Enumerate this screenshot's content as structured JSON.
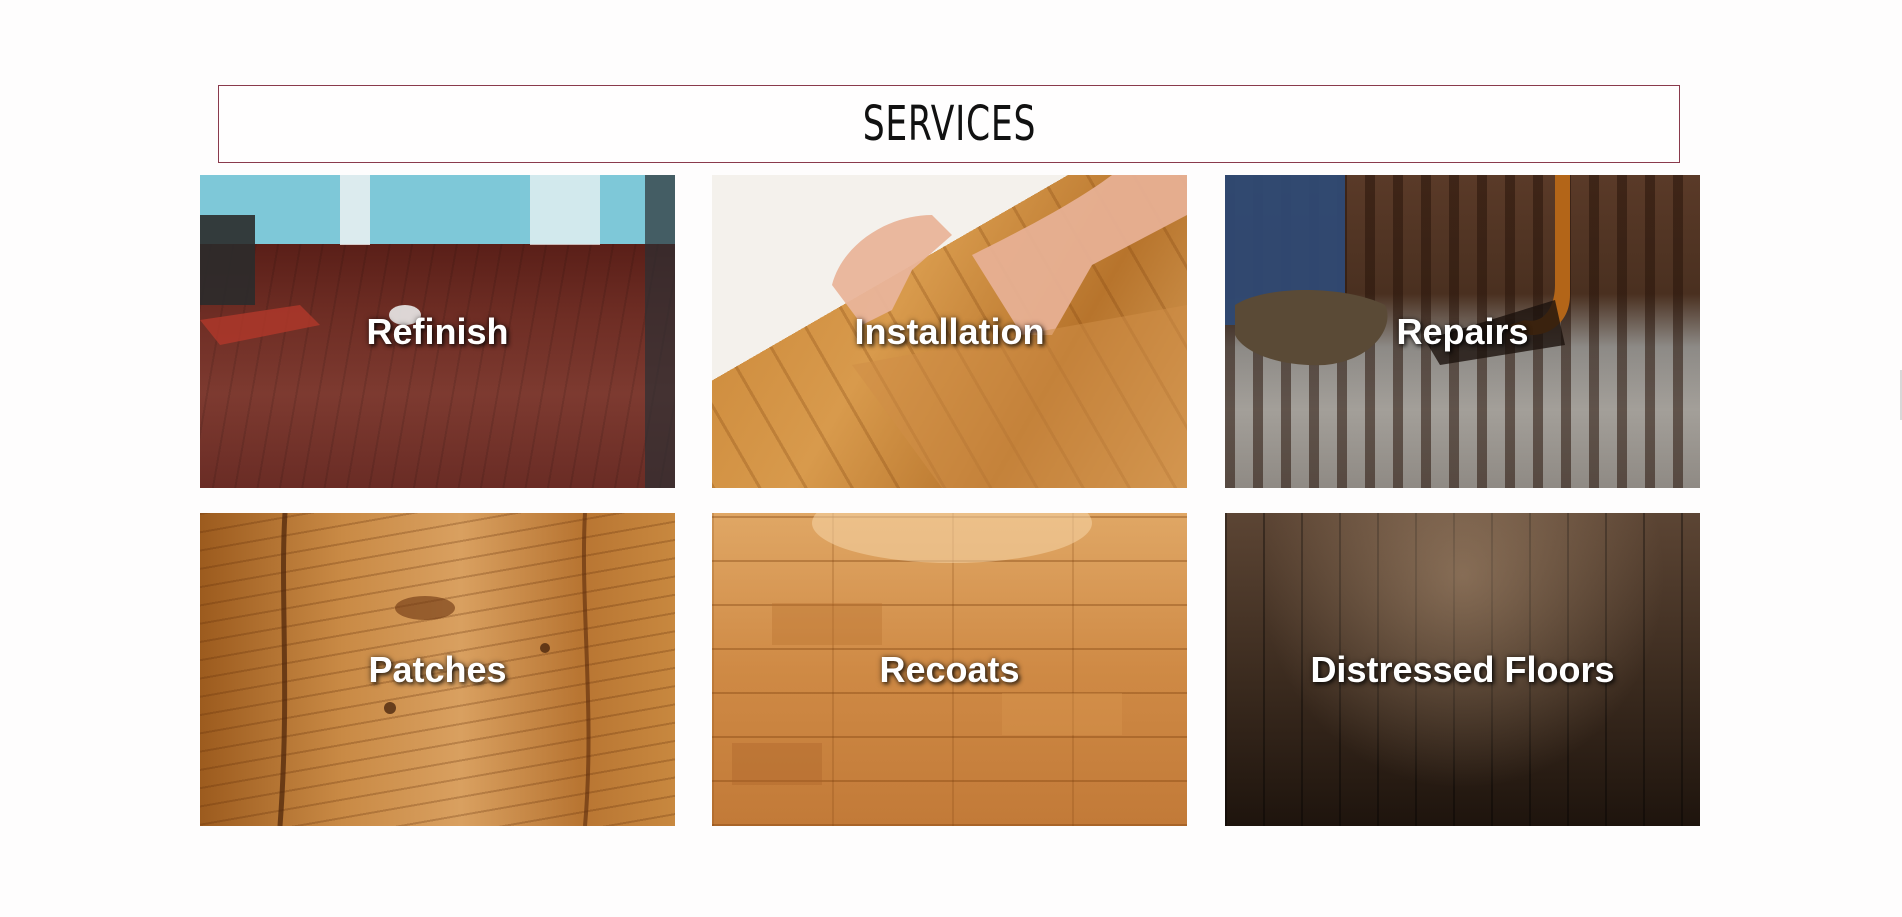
{
  "header": {
    "title": "SERVICES"
  },
  "services": [
    {
      "label": "Refinish",
      "image_icon": "refinish-floor-photo"
    },
    {
      "label": "Installation",
      "image_icon": "installation-floor-photo"
    },
    {
      "label": "Repairs",
      "image_icon": "repairs-floor-photo"
    },
    {
      "label": "Patches",
      "image_icon": "patches-wood-photo"
    },
    {
      "label": "Recoats",
      "image_icon": "recoats-floor-photo"
    },
    {
      "label": "Distressed Floors",
      "image_icon": "distressed-floor-photo"
    }
  ],
  "colors": {
    "title_border": "#8a3a4c",
    "label_text": "#ffffff",
    "background": "#fefdfd"
  }
}
